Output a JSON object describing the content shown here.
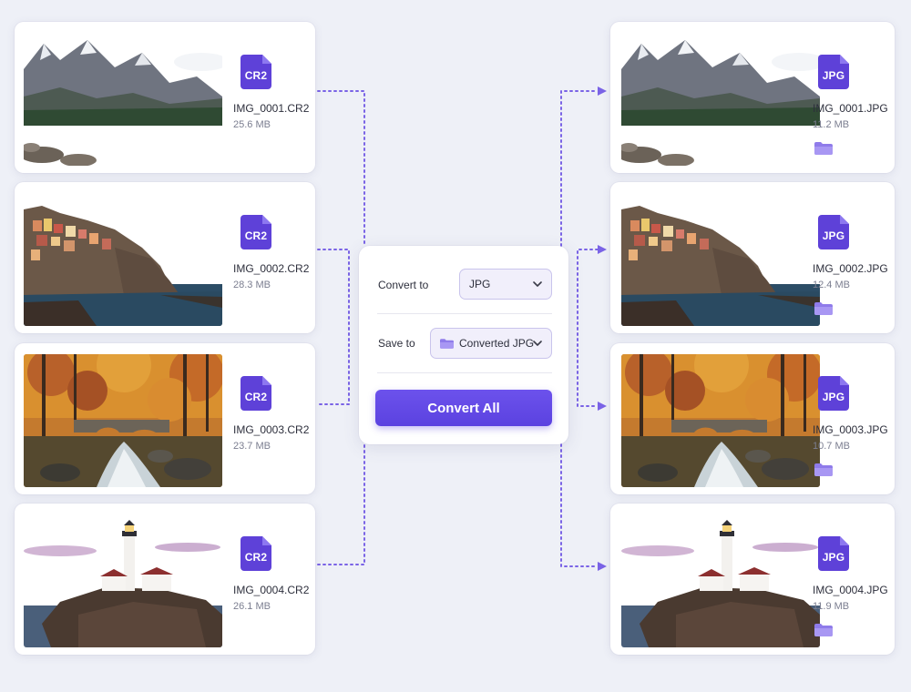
{
  "source_files": [
    {
      "name": "IMG_0001.CR2",
      "size": "25.6 MB",
      "badge": "CR2",
      "scene": "mountain-lake"
    },
    {
      "name": "IMG_0002.CR2",
      "size": "28.3 MB",
      "badge": "CR2",
      "scene": "cliff-village"
    },
    {
      "name": "IMG_0003.CR2",
      "size": "23.7 MB",
      "badge": "CR2",
      "scene": "autumn-bridge"
    },
    {
      "name": "IMG_0004.CR2",
      "size": "26.1 MB",
      "badge": "CR2",
      "scene": "lighthouse"
    }
  ],
  "output_files": [
    {
      "name": "IMG_0001.JPG",
      "size": "11.2 MB",
      "badge": "JPG",
      "scene": "mountain-lake"
    },
    {
      "name": "IMG_0002.JPG",
      "size": "12.4 MB",
      "badge": "JPG",
      "scene": "cliff-village"
    },
    {
      "name": "IMG_0003.JPG",
      "size": "10.7 MB",
      "badge": "JPG",
      "scene": "autumn-bridge"
    },
    {
      "name": "IMG_0004.JPG",
      "size": "11.9 MB",
      "badge": "JPG",
      "scene": "lighthouse"
    }
  ],
  "panel": {
    "convert_label": "Convert to",
    "format_value": "JPG",
    "save_label": "Save to",
    "folder_value": "Converted JPG",
    "button_label": "Convert All"
  },
  "icons": {
    "file": "file-icon",
    "folder": "folder-icon",
    "chevron": "chevron-down-icon",
    "arrow": "arrow-right-icon"
  },
  "colors": {
    "accent": "#5b42e0",
    "file_icon": "#5e41d8",
    "connector": "#7a63e6",
    "background": "#eef0f7"
  }
}
